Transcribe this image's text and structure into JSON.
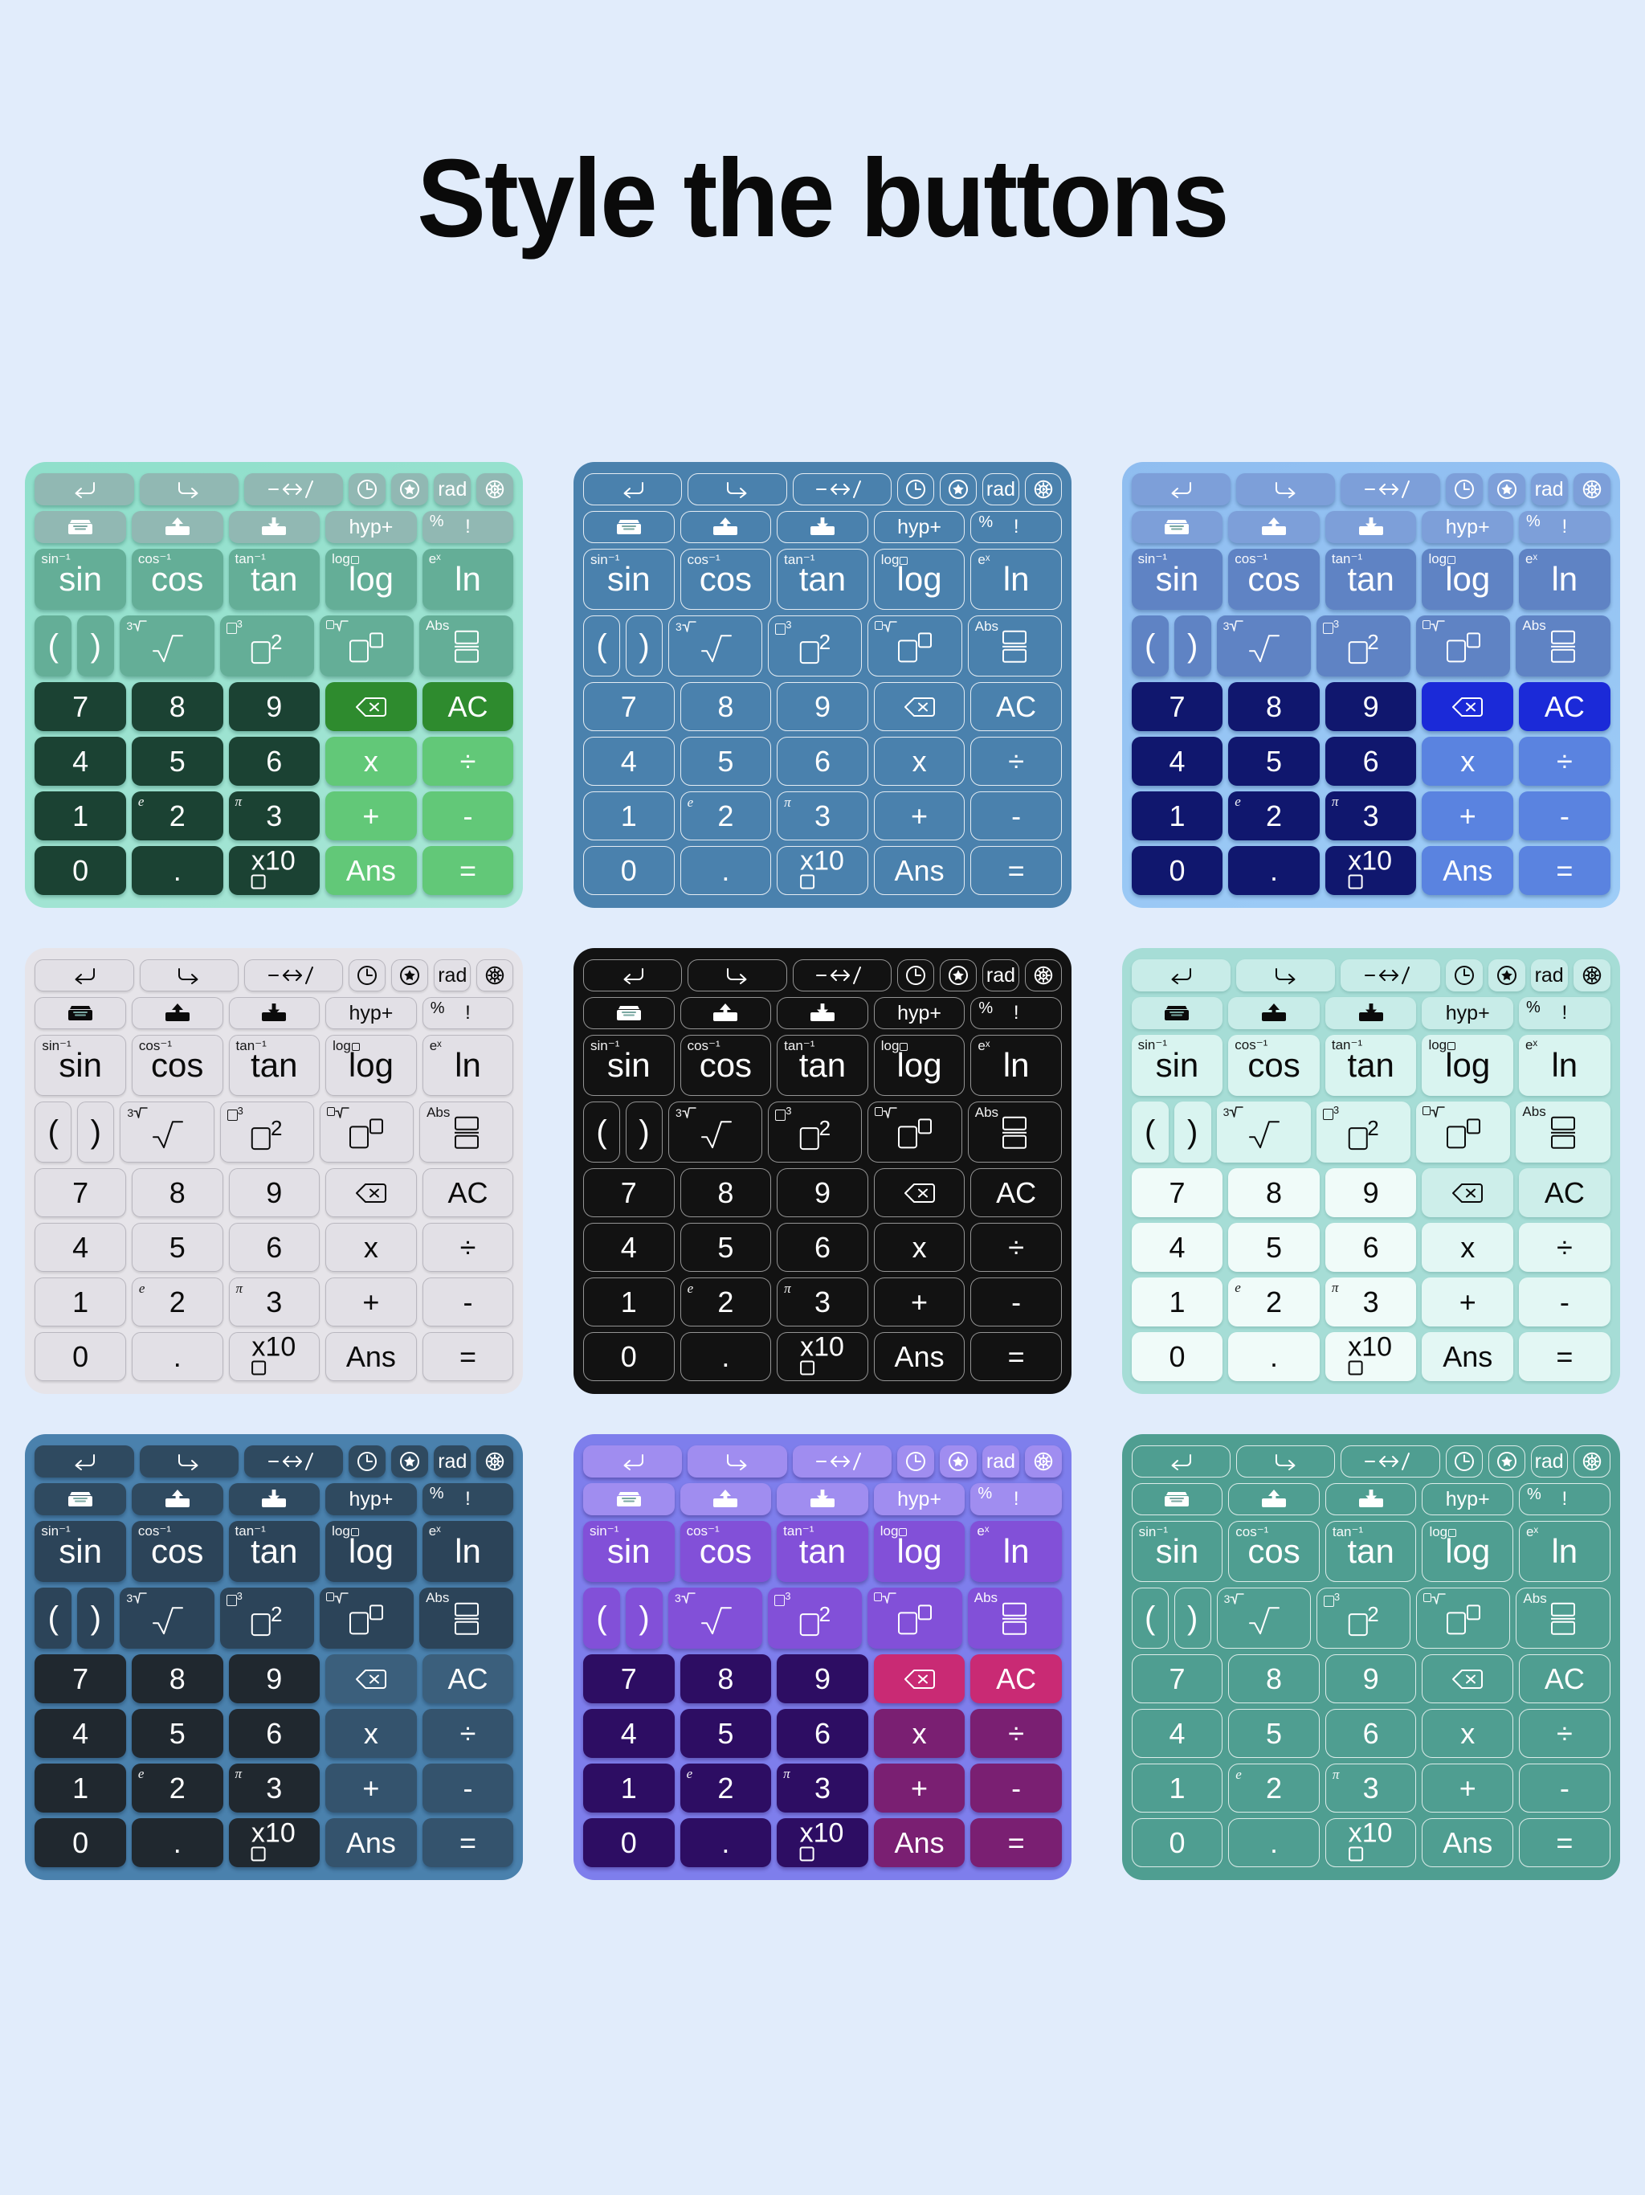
{
  "page": {
    "title": "Style the buttons",
    "background_color": "#e1ecfb"
  },
  "keypad": {
    "rows": [
      {
        "name": "utility-row-1",
        "keys": [
          {
            "id": "undo",
            "icon": "undo-icon",
            "label": "",
            "kind": "util",
            "span": "wide2"
          },
          {
            "id": "redo",
            "icon": "redo-icon",
            "label": "",
            "kind": "util",
            "span": "wide2"
          },
          {
            "id": "fraction-toggle",
            "icon": "minus-arrows-slash-icon",
            "label": "−↔/",
            "kind": "util",
            "span": "wide2"
          },
          {
            "id": "history",
            "icon": "clock-icon",
            "label": "",
            "kind": "util",
            "span": "narrow"
          },
          {
            "id": "favorites",
            "icon": "star-circle-icon",
            "label": "",
            "kind": "util",
            "span": "narrow"
          },
          {
            "id": "angle-mode",
            "icon": "",
            "label": "rad",
            "kind": "util",
            "span": "narrow"
          },
          {
            "id": "settings",
            "icon": "gear-icon",
            "label": "",
            "kind": "util",
            "span": "narrow"
          }
        ]
      },
      {
        "name": "utility-row-2",
        "keys": [
          {
            "id": "archive",
            "icon": "tray-icon",
            "label": "",
            "kind": "util",
            "span": "wide2"
          },
          {
            "id": "export",
            "icon": "tray-upload-icon",
            "label": "",
            "kind": "util",
            "span": "wide2"
          },
          {
            "id": "import",
            "icon": "tray-download-icon",
            "label": "",
            "kind": "util",
            "span": "wide2"
          },
          {
            "id": "hyp",
            "icon": "",
            "label": "hyp+",
            "kind": "util",
            "span": "wide2"
          },
          {
            "id": "percent-factorial",
            "icon": "",
            "label": "",
            "sup": "%",
            "alt": "!",
            "kind": "util",
            "span": "wide2"
          }
        ]
      },
      {
        "name": "function-row",
        "keys": [
          {
            "id": "sin",
            "label": "sin",
            "sup": "sin⁻¹",
            "kind": "func"
          },
          {
            "id": "cos",
            "label": "cos",
            "sup": "cos⁻¹",
            "kind": "func"
          },
          {
            "id": "tan",
            "label": "tan",
            "sup": "tan⁻¹",
            "kind": "func"
          },
          {
            "id": "log",
            "label": "log",
            "sup": "log□",
            "kind": "func"
          },
          {
            "id": "ln",
            "label": "ln",
            "sup": "eˣ",
            "kind": "func"
          }
        ]
      },
      {
        "name": "paren-power-row",
        "keys": [
          {
            "id": "open-paren",
            "label": "(",
            "kind": "func",
            "span": "paren"
          },
          {
            "id": "close-paren",
            "label": ")",
            "kind": "func",
            "span": "paren"
          },
          {
            "id": "sqrt",
            "label": "√",
            "sup": "³√",
            "kind": "func"
          },
          {
            "id": "square",
            "label": "□²",
            "sup": "□³",
            "kind": "func"
          },
          {
            "id": "power",
            "label": "□^□",
            "sup": "□√",
            "kind": "func"
          },
          {
            "id": "fraction",
            "label": "□/□",
            "sup": "Abs",
            "kind": "func"
          }
        ]
      },
      {
        "name": "digit-row-789",
        "keys": [
          {
            "id": "digit-7",
            "label": "7",
            "kind": "dig"
          },
          {
            "id": "digit-8",
            "label": "8",
            "kind": "dig"
          },
          {
            "id": "digit-9",
            "label": "9",
            "kind": "dig"
          },
          {
            "id": "backspace",
            "icon": "backspace-icon",
            "label": "",
            "kind": "del"
          },
          {
            "id": "all-clear",
            "label": "AC",
            "kind": "del"
          }
        ]
      },
      {
        "name": "digit-row-456",
        "keys": [
          {
            "id": "digit-4",
            "label": "4",
            "kind": "dig"
          },
          {
            "id": "digit-5",
            "label": "5",
            "kind": "dig"
          },
          {
            "id": "digit-6",
            "label": "6",
            "kind": "dig"
          },
          {
            "id": "multiply",
            "label": "x",
            "kind": "op"
          },
          {
            "id": "divide",
            "label": "÷",
            "kind": "op"
          }
        ]
      },
      {
        "name": "digit-row-123",
        "keys": [
          {
            "id": "digit-1",
            "label": "1",
            "kind": "dig"
          },
          {
            "id": "digit-2",
            "label": "2",
            "sup": "e",
            "supItalic": true,
            "kind": "dig"
          },
          {
            "id": "digit-3",
            "label": "3",
            "sup": "π",
            "supItalic": true,
            "kind": "dig"
          },
          {
            "id": "plus",
            "label": "+",
            "kind": "op"
          },
          {
            "id": "minus",
            "label": "-",
            "kind": "op"
          }
        ]
      },
      {
        "name": "digit-row-0",
        "keys": [
          {
            "id": "digit-0",
            "label": "0",
            "kind": "dig"
          },
          {
            "id": "decimal-point",
            "label": ".",
            "kind": "dig"
          },
          {
            "id": "exponent",
            "label": "x10□",
            "kind": "dig"
          },
          {
            "id": "answer",
            "label": "Ans",
            "kind": "eq"
          },
          {
            "id": "equals",
            "label": "=",
            "kind": "eq"
          }
        ]
      }
    ]
  },
  "themes": [
    {
      "id": "mint-raised",
      "name": "theme-mint-raised",
      "class": "t1",
      "panel": "#8fdfcb",
      "accent": "#62c878"
    },
    {
      "id": "steel-outline",
      "name": "theme-steel-outline",
      "class": "t2",
      "panel": "#4a81ad",
      "accent": "#ffffff"
    },
    {
      "id": "royal-blue",
      "name": "theme-royal-blue",
      "class": "t3",
      "panel": "#9ecdf7",
      "accent": "#1b2ad8"
    },
    {
      "id": "light-grey",
      "name": "theme-light-grey",
      "class": "t4",
      "panel": "#e6e4e9",
      "accent": "#b9b7bf"
    },
    {
      "id": "black-outline",
      "name": "theme-black-outline",
      "class": "t5",
      "panel": "#121212",
      "accent": "#ffffff"
    },
    {
      "id": "mint-light",
      "name": "theme-mint-light",
      "class": "t6",
      "panel": "#a6ddd6",
      "accent": "#f0fbf9"
    },
    {
      "id": "slate-blue-dark",
      "name": "theme-slate-blue-dark",
      "class": "t7",
      "panel": "#4a81ad",
      "accent": "#20282f"
    },
    {
      "id": "purple-magenta",
      "name": "theme-purple-magenta",
      "class": "t8",
      "panel": "#7e7eec",
      "accent": "#c92a74"
    },
    {
      "id": "sea-green-outline",
      "name": "theme-sea-green-outline",
      "class": "t9",
      "panel": "#4f9e91",
      "accent": "#ffffff"
    }
  ]
}
